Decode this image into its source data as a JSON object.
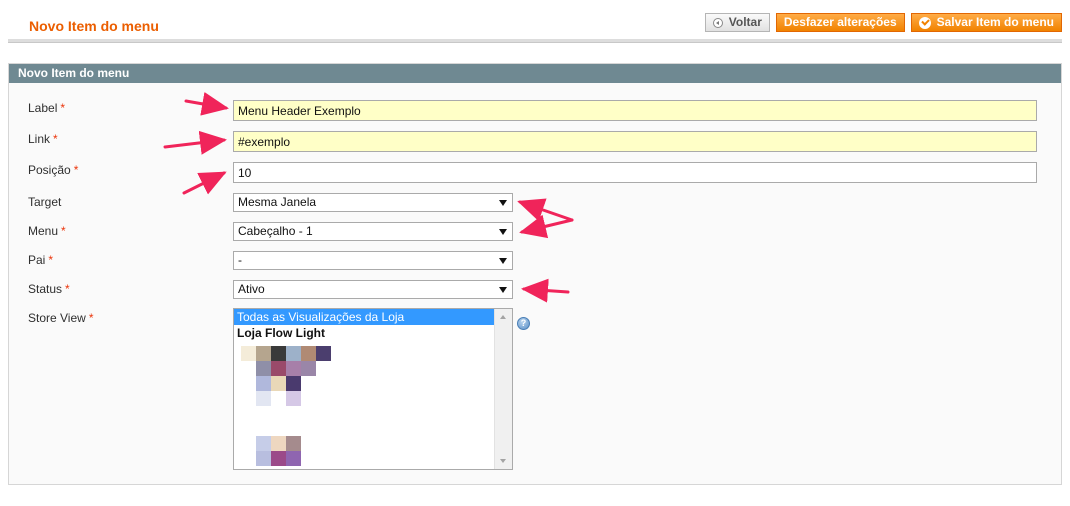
{
  "header": {
    "title": "Novo Item do menu",
    "back_label": "Voltar",
    "reset_label": "Desfazer alterações",
    "save_label": "Salvar Item do menu"
  },
  "fieldset": {
    "title": "Novo Item do menu"
  },
  "form": {
    "label": {
      "label": "Label",
      "required": "*",
      "value": "Menu Header Exemplo"
    },
    "link": {
      "label": "Link",
      "required": "*",
      "value": "#exemplo"
    },
    "position": {
      "label": "Posição",
      "required": "*",
      "value": "10"
    },
    "target": {
      "label": "Target",
      "selected": "Mesma Janela"
    },
    "menu": {
      "label": "Menu",
      "required": "*",
      "selected": "Cabeçalho - 1"
    },
    "parent": {
      "label": "Pai",
      "required": "*",
      "selected": "-"
    },
    "status": {
      "label": "Status",
      "required": "*",
      "selected": "Ativo"
    },
    "store_view": {
      "label": "Store View",
      "required": "*",
      "options": [
        "Todas as Visualizações da Loja",
        "Loja Flow Light"
      ]
    }
  },
  "colors": {
    "accent": "#eb5e00",
    "button_orange": "#f18200",
    "fieldset_header": "#6f8992",
    "highlight_input": "#ffffc7",
    "selected_option": "#3399ff",
    "annotation_arrow": "#f0245a"
  },
  "icons": {
    "back": "back-arrow-icon",
    "save": "check-icon",
    "help": "help-icon",
    "dropdown": "chevron-down-icon"
  }
}
